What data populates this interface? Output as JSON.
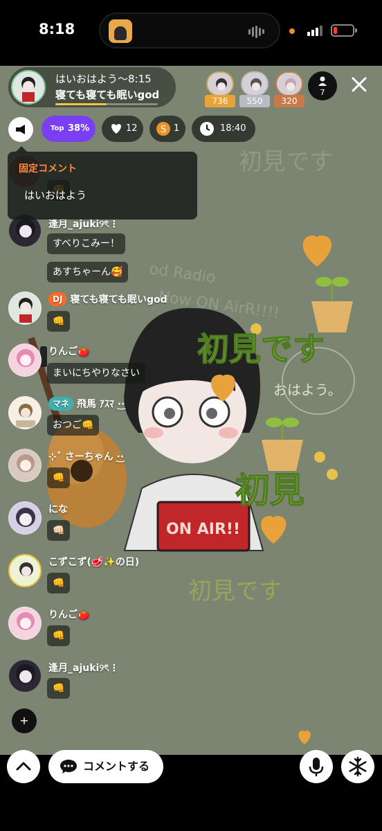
{
  "status_bar": {
    "time": "8:18"
  },
  "host": {
    "time_label": "はいおはよう～8:15",
    "name": "寝ても寝ても眠いgod",
    "progress": 0.5
  },
  "ranking": [
    {
      "score": "736",
      "color": "#e8a437"
    },
    {
      "score": "550",
      "color": "#b8bcc2"
    },
    {
      "score": "320",
      "color": "#c97a4a"
    }
  ],
  "viewer_count": "7",
  "chips": {
    "top_label": "Top",
    "top_value": "38%",
    "likes": "12",
    "coins": "1",
    "timer": "18:40"
  },
  "pinned": {
    "title": "固定コメント",
    "text": "はいおはよう"
  },
  "comments": [
    {
      "name": "逢月_ajuki୨ৎ⋮",
      "messages": [
        "すべりこみー！",
        "あすちゃーん🥰"
      ]
    },
    {
      "badge": "DJ",
      "name": "寝ても寝ても眠いgod",
      "messages": [
        "👊"
      ]
    },
    {
      "name": "りんご🍅",
      "messages": [
        "まいにちやりなさい"
      ]
    },
    {
      "badge": "マネ",
      "name": "飛馬 ｱｽﾏ ·͜·",
      "messages": [
        "おつご👊"
      ]
    },
    {
      "name": "⊹˚ さーちゃん ·͜·",
      "messages": [
        "👊"
      ]
    },
    {
      "name": "にな",
      "messages": [
        "👊🏻"
      ]
    },
    {
      "name": "こずこず(🥩✨の日)",
      "messages": [
        "👊"
      ]
    },
    {
      "name": "りんご🍅",
      "messages": [
        "👊"
      ]
    },
    {
      "name": "逢月_ajuki୨ৎ⋮",
      "messages": [
        "👊"
      ]
    }
  ],
  "background_art": {
    "text_top": "初見です",
    "radio_line1": "od Radio",
    "radio_line2": "Now ON AirR!!!!",
    "center_big": "初見です",
    "center_small": "おはよう。",
    "side_big": "初見",
    "bottom": "初見です",
    "sign": "ON AIR!!"
  },
  "bottom_bar": {
    "comment_label": "コメントする"
  },
  "colors": {
    "accent_purple": "#7b3ff2",
    "pinned_title": "#ff8a3d",
    "stream_bg": "#7a8470"
  }
}
